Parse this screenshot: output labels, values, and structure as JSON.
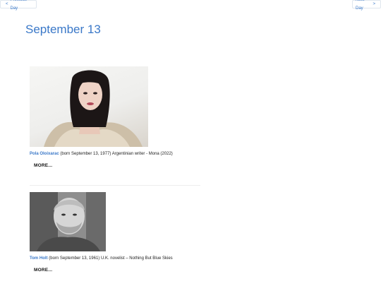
{
  "nav": {
    "prev_arrow": "<",
    "prev_label": "Previous Day",
    "next_label": "Next Day",
    "next_arrow": ">"
  },
  "page": {
    "title": "September 13"
  },
  "entries": [
    {
      "name": "Pola Oloixarac",
      "detail": " (born September 13, 1977) Argentinian writer - Mona (2022)",
      "more_label": "MORE..."
    },
    {
      "name": "Tom Holt",
      "detail": " (born September 13, 1961) U.K. novelist – Nothing But Blue Skies",
      "more_label": "MORE..."
    }
  ]
}
